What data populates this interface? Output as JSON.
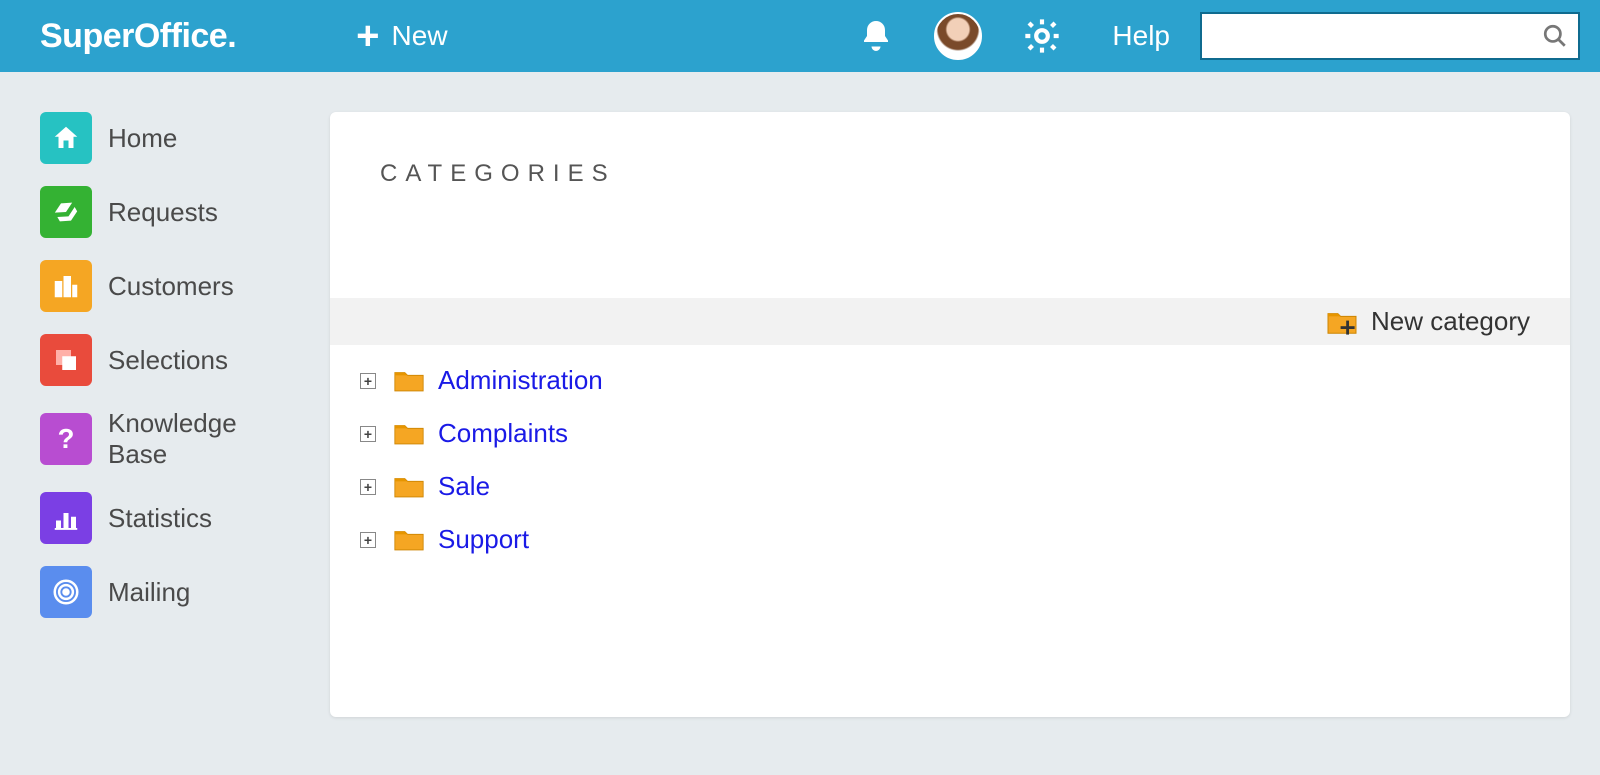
{
  "brand": "SuperOffice",
  "topbar": {
    "new_label": "New",
    "help_label": "Help",
    "search_placeholder": ""
  },
  "sidebar": {
    "items": [
      {
        "label": "Home",
        "icon": "home",
        "color": "#26c2c2"
      },
      {
        "label": "Requests",
        "icon": "ticket",
        "color": "#34b233"
      },
      {
        "label": "Customers",
        "icon": "buildings",
        "color": "#f5a623"
      },
      {
        "label": "Selections",
        "icon": "squares",
        "color": "#e94b3c"
      },
      {
        "label": "Knowledge Base",
        "icon": "question",
        "color": "#b84dd1"
      },
      {
        "label": "Statistics",
        "icon": "chart",
        "color": "#7b3fe4"
      },
      {
        "label": "Mailing",
        "icon": "target",
        "color": "#5a8dee"
      }
    ]
  },
  "main": {
    "title": "CATEGORIES",
    "new_category_label": "New category",
    "categories": [
      {
        "label": "Administration"
      },
      {
        "label": "Complaints"
      },
      {
        "label": "Sale"
      },
      {
        "label": "Support"
      }
    ]
  }
}
